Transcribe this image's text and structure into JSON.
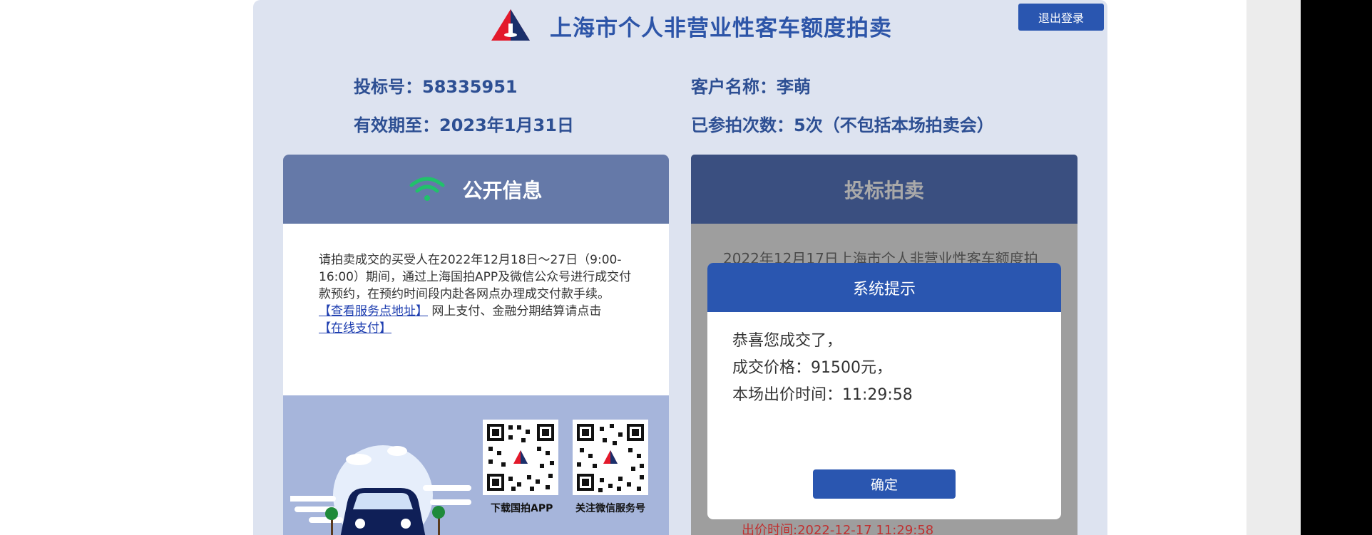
{
  "header": {
    "title": "上海市个人非营业性客车额度拍卖",
    "logout_label": "退出登录"
  },
  "bidder": {
    "bid_no_label": "投标号：",
    "bid_no": "58335951",
    "customer_label": "客户名称：",
    "customer": "李萌",
    "valid_label": "有效期至：",
    "valid_until": "2023年1月31日",
    "count_label": "已参拍次数：",
    "count": "5次（不包括本场拍卖会）"
  },
  "public_info": {
    "title": "公开信息",
    "notice": "请拍卖成交的买受人在2022年12月18日～27日（9:00-16:00）期间，通过上海国拍APP及微信公众号进行成交付款预约，在预约时间段内赴各网点办理成交付款手续。",
    "service_link": "【查看服务点地址】",
    "online_text": " 网上支付、金融分期结算请点击",
    "pay_link": "【在线支付】",
    "qr_app_label": "下载国拍APP",
    "qr_wechat_label": "关注微信服务号"
  },
  "bidding": {
    "title": "投标拍卖",
    "text": "2022年12月17日上海市个人非营业性客车额度拍",
    "bid_time": "出价时间:2022-12-17 11:29:58"
  },
  "modal": {
    "title": "系统提示",
    "line1": "恭喜您成交了，",
    "line2": "成交价格：91500元，",
    "line3": "本场出价时间：11:29:58",
    "ok_label": "确定"
  },
  "colors": {
    "brand_blue": "#2a56b0",
    "title_blue": "#2d55a8",
    "wifi_green": "#21c16b",
    "bid_time_red": "#c03030"
  }
}
